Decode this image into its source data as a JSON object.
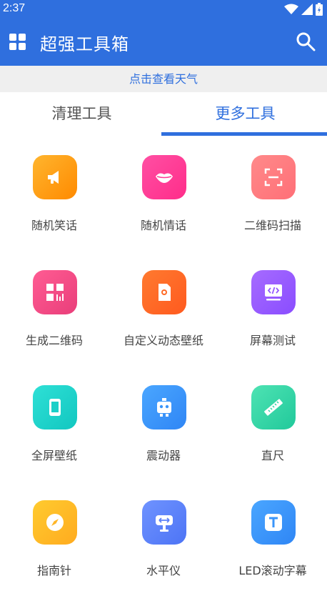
{
  "status": {
    "time": "2:37"
  },
  "app_bar": {
    "title": "超强工具箱"
  },
  "weather": {
    "label": "点击查看天气"
  },
  "tabs": [
    {
      "label": "清理工具",
      "active": false
    },
    {
      "label": "更多工具",
      "active": true
    }
  ],
  "colors": {
    "primary": "#2f6fde",
    "weather_bg": "#efefef"
  },
  "tools": [
    {
      "label": "随机笑话",
      "icon": "megaphone-icon"
    },
    {
      "label": "随机情话",
      "icon": "lips-icon"
    },
    {
      "label": "二维码扫描",
      "icon": "scan-icon"
    },
    {
      "label": "生成二维码",
      "icon": "qrcode-icon"
    },
    {
      "label": "自定义动态壁纸",
      "icon": "wallpaper-icon"
    },
    {
      "label": "屏幕测试",
      "icon": "code-screen-icon"
    },
    {
      "label": "全屏壁纸",
      "icon": "phone-icon"
    },
    {
      "label": "震动器",
      "icon": "robot-icon"
    },
    {
      "label": "直尺",
      "icon": "ruler-icon"
    },
    {
      "label": "指南针",
      "icon": "compass-icon"
    },
    {
      "label": "水平仪",
      "icon": "level-icon"
    },
    {
      "label": "LED滚动字幕",
      "icon": "text-icon"
    }
  ]
}
